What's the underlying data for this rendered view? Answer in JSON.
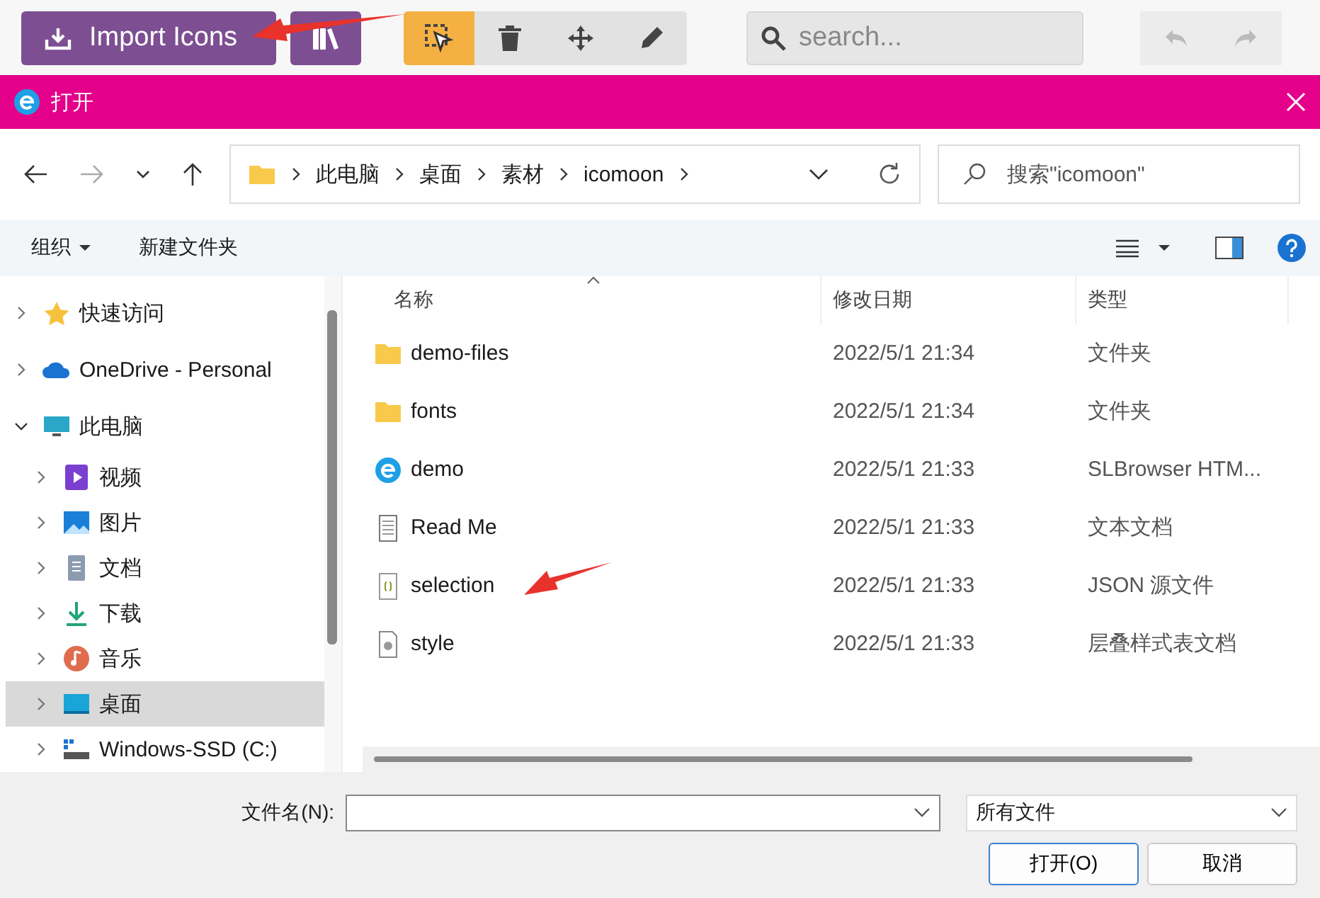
{
  "app_toolbar": {
    "import_button": "Import Icons",
    "tools": [
      {
        "kind": "select",
        "selected": true
      },
      {
        "kind": "delete",
        "selected": false
      },
      {
        "kind": "move",
        "selected": false
      },
      {
        "kind": "edit",
        "selected": false
      }
    ],
    "search": {
      "placeholder": "search..."
    }
  },
  "window": {
    "title": "打开"
  },
  "address_bar": {
    "path": [
      "此电脑",
      "桌面",
      "素材",
      "icomoon"
    ],
    "search": {
      "placeholder": "搜索\"icomoon\""
    }
  },
  "command_bar": {
    "organize": "组织",
    "new_folder": "新建文件夹"
  },
  "sidebar": {
    "items": [
      {
        "label": "快速访问",
        "kind": "star",
        "expanded": false,
        "selected": false
      },
      {
        "label": "OneDrive - Personal",
        "kind": "cloud",
        "expanded": false,
        "selected": false
      },
      {
        "label": "此电脑",
        "kind": "pc",
        "expanded": true,
        "selected": false,
        "children": [
          {
            "label": "视频",
            "kind": "video",
            "expanded": false,
            "selected": false
          },
          {
            "label": "图片",
            "kind": "picture",
            "expanded": false,
            "selected": false
          },
          {
            "label": "文档",
            "kind": "document",
            "expanded": false,
            "selected": false
          },
          {
            "label": "下载",
            "kind": "download",
            "expanded": false,
            "selected": false
          },
          {
            "label": "音乐",
            "kind": "music",
            "expanded": false,
            "selected": false
          },
          {
            "label": "桌面",
            "kind": "desktop",
            "expanded": false,
            "selected": true
          },
          {
            "label": "Windows-SSD (C:)",
            "kind": "drive",
            "expanded": false,
            "selected": false
          }
        ]
      }
    ]
  },
  "table": {
    "columns": [
      "名称",
      "修改日期",
      "类型"
    ],
    "rows": [
      {
        "name": "demo-files",
        "kind": "folder",
        "date": "2022/5/1 21:34",
        "type": "文件夹"
      },
      {
        "name": "fonts",
        "kind": "folder",
        "date": "2022/5/1 21:34",
        "type": "文件夹"
      },
      {
        "name": "demo",
        "kind": "browser",
        "date": "2022/5/1 21:33",
        "type": "SLBrowser HTM..."
      },
      {
        "name": "Read Me",
        "kind": "text",
        "date": "2022/5/1 21:33",
        "type": "文本文档"
      },
      {
        "name": "selection",
        "kind": "json",
        "date": "2022/5/1 21:33",
        "type": "JSON 源文件"
      },
      {
        "name": "style",
        "kind": "css",
        "date": "2022/5/1 21:33",
        "type": "层叠样式表文档"
      }
    ]
  },
  "footer": {
    "filename_label": "文件名(N):",
    "filter": "所有文件",
    "open_button": "打开(O)",
    "cancel_button": "取消"
  }
}
